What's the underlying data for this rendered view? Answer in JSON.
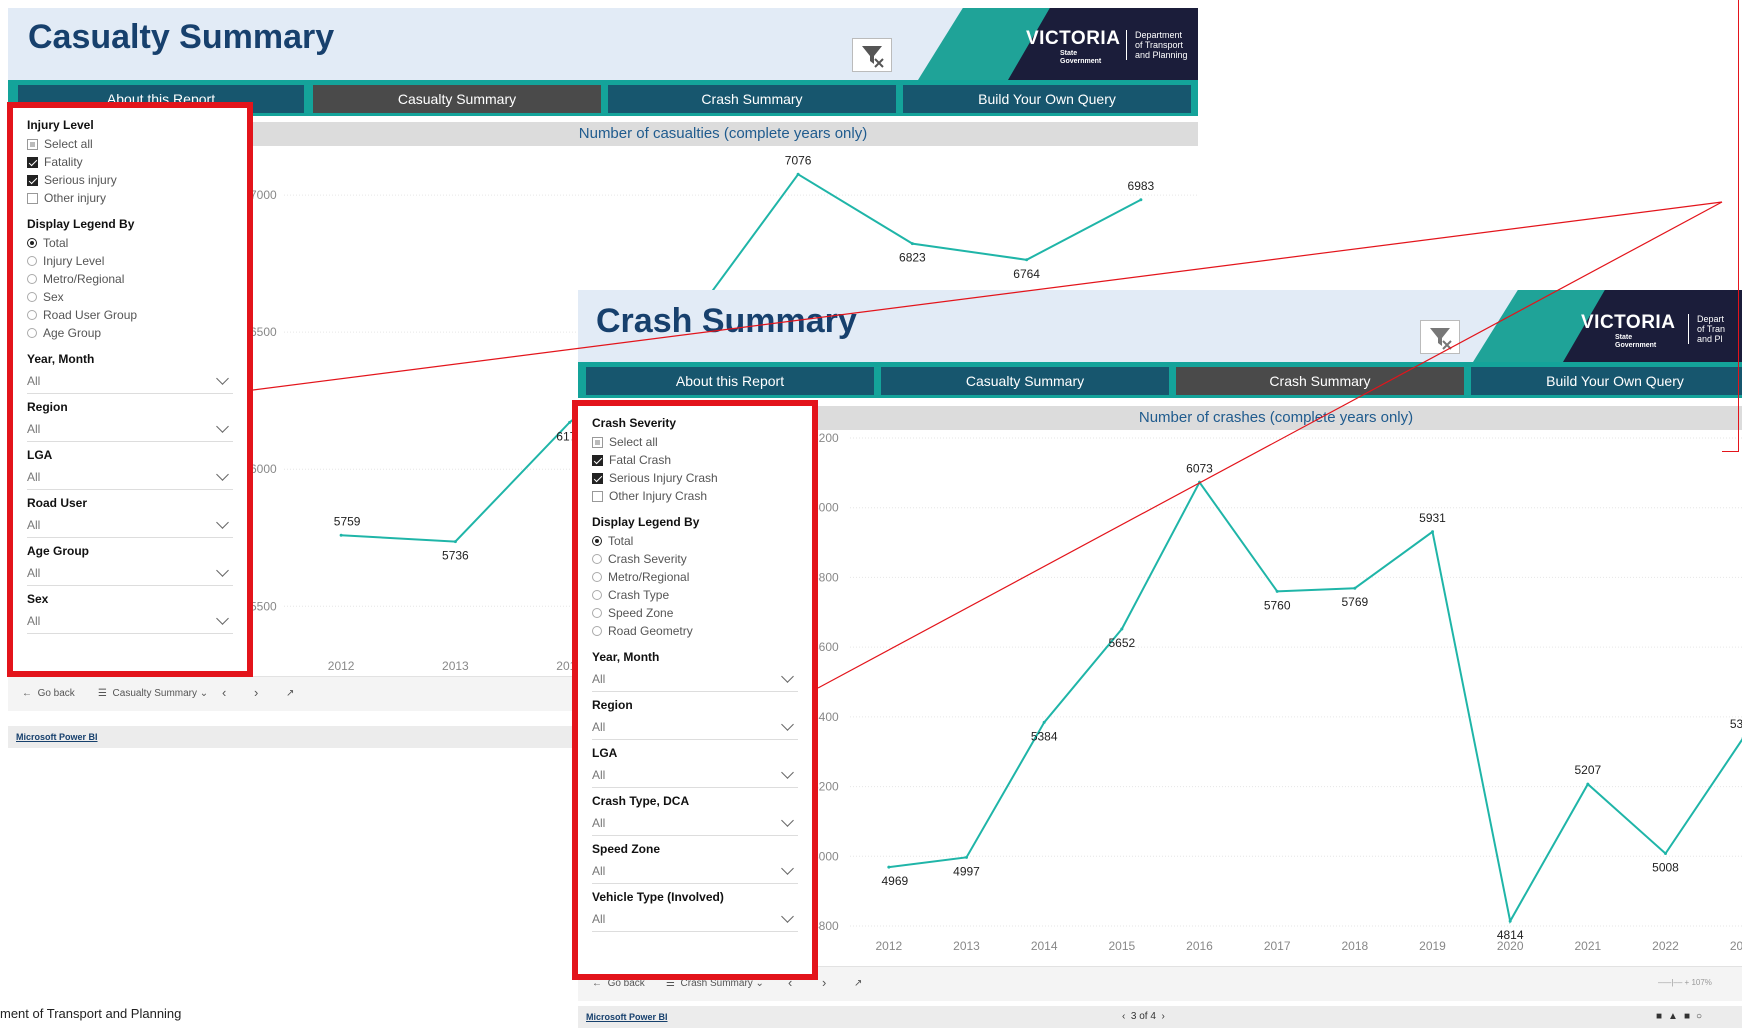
{
  "casualty": {
    "title": "Casualty Summary",
    "tabs": [
      "About this Report",
      "Casualty Summary",
      "Crash Summary",
      "Build Your Own Query"
    ],
    "chart_title": "Number of casualties (complete years only)",
    "filters": {
      "injury_level_label": "Injury Level",
      "injury_options": [
        "Select all",
        "Fatality",
        "Serious injury",
        "Other injury"
      ],
      "legend_label": "Display Legend By",
      "legend_options": [
        "Total",
        "Injury Level",
        "Metro/Regional",
        "Sex",
        "Road User Group",
        "Age Group"
      ],
      "dropdowns": [
        {
          "label": "Year, Month",
          "value": "All"
        },
        {
          "label": "Region",
          "value": "All"
        },
        {
          "label": "LGA",
          "value": "All"
        },
        {
          "label": "Road User",
          "value": "All"
        },
        {
          "label": "Age Group",
          "value": "All"
        },
        {
          "label": "Sex",
          "value": "All"
        }
      ]
    },
    "statusbar": {
      "go_back": "Go back",
      "page": "Casualty Summary"
    },
    "footer_link": "Microsoft Power BI",
    "logo": {
      "name": "VICTORIA",
      "sub1": "State",
      "sub2": "Government",
      "dept1": "Department",
      "dept2": "of Transport",
      "dept3": "and Planning"
    }
  },
  "crash": {
    "title": "Crash Summary",
    "tabs": [
      "About this Report",
      "Casualty Summary",
      "Crash Summary",
      "Build Your Own Query"
    ],
    "chart_title": "Number of crashes (complete years only)",
    "filters": {
      "severity_label": "Crash Severity",
      "severity_options": [
        "Select all",
        "Fatal Crash",
        "Serious Injury Crash",
        "Other Injury Crash"
      ],
      "legend_label": "Display Legend By",
      "legend_options": [
        "Total",
        "Crash Severity",
        "Metro/Regional",
        "Crash Type",
        "Speed Zone",
        "Road Geometry"
      ],
      "dropdowns": [
        {
          "label": "Year, Month",
          "value": "All"
        },
        {
          "label": "Region",
          "value": "All"
        },
        {
          "label": "LGA",
          "value": "All"
        },
        {
          "label": "Crash Type, DCA",
          "value": "All"
        },
        {
          "label": "Speed Zone",
          "value": "All"
        },
        {
          "label": "Vehicle Type (Involved)",
          "value": "All"
        }
      ]
    },
    "statusbar": {
      "go_back": "Go back",
      "page": "Crash Summary",
      "pager": "3 of 4",
      "zoom": "107%"
    },
    "footer_link": "Microsoft Power BI",
    "logo": {
      "name": "VICTORIA",
      "sub1": "State",
      "sub2": "Government",
      "dept1": "Depart",
      "dept2": "of Tran",
      "dept3": "and Pl"
    }
  },
  "footnote": "ment of Transport and Planning",
  "colors": {
    "line": "#1fb5a8",
    "banner": "#e2ebf6",
    "nav": "#14a39a",
    "tab": "#17566e",
    "tab_active": "#4a4a4a",
    "highlight": "#e3141b"
  },
  "chart_data": [
    {
      "type": "line",
      "title": "Number of casualties (complete years only)",
      "x": [
        2012,
        2013,
        2014,
        2015,
        2016,
        2017,
        2018,
        2019
      ],
      "values": [
        5759,
        5736,
        6171,
        6509,
        7076,
        6823,
        6764,
        6983
      ],
      "yticks": [
        5500,
        6000,
        6500,
        7000
      ],
      "ylim": [
        5450,
        7150
      ]
    },
    {
      "type": "line",
      "title": "Number of crashes (complete years only)",
      "x": [
        2012,
        2013,
        2014,
        2015,
        2016,
        2017,
        2018,
        2019,
        2020,
        2021,
        2022,
        2023
      ],
      "values": [
        4969,
        4997,
        5384,
        5652,
        6073,
        5760,
        5769,
        5931,
        4814,
        5207,
        5008,
        5339
      ],
      "yticks": [
        4800,
        5000,
        5200,
        5400,
        5600,
        5800,
        6000,
        6200
      ],
      "ylim": [
        4800,
        6200
      ]
    }
  ]
}
